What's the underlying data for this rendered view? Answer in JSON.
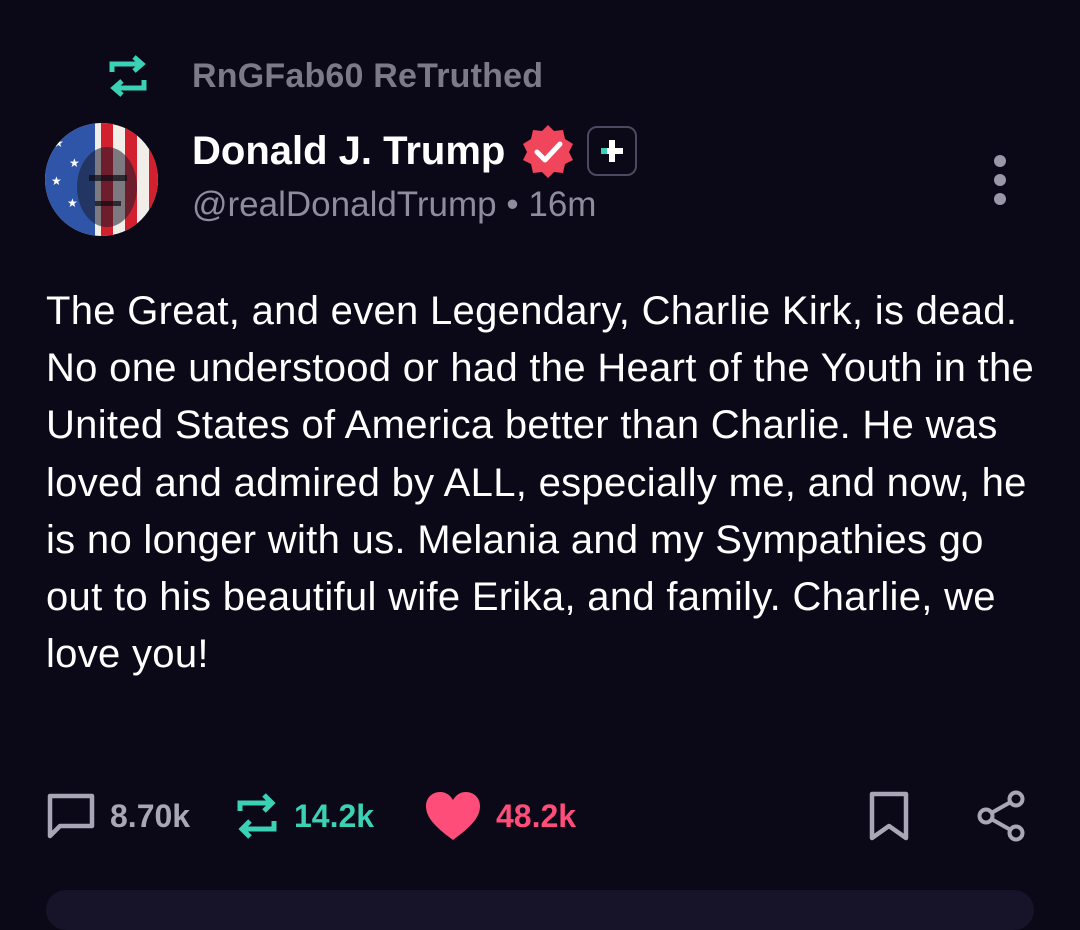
{
  "retruth_banner": {
    "label": "RnGFab60 ReTruthed",
    "icon": "retruth-icon"
  },
  "author": {
    "display_name": "Donald J. Trump",
    "handle": "@realDonaldTrump",
    "separator": "•",
    "time_ago": "16m",
    "verified_icon": "verified-badge-icon",
    "plus_icon": "plus-icon",
    "avatar": "avatar-image"
  },
  "post": {
    "text": "The Great, and even Legendary, Charlie Kirk, is dead. No one understood or had the Heart of the Youth in the United States of America better than Charlie. He was loved and admired by ALL, especially me, and now, he is no longer with us. Melania and my Sympathies go out to his beautiful wife Erika, and family. Charlie, we love you!"
  },
  "actions": {
    "reply_count": "8.70k",
    "retruth_count": "14.2k",
    "like_count": "48.2k",
    "reply_icon": "comment-icon",
    "retruth_icon": "retruth-icon",
    "like_icon": "heart-icon",
    "bookmark_icon": "bookmark-icon",
    "share_icon": "share-icon",
    "more_icon": "more-vertical-icon"
  },
  "colors": {
    "background": "#0b0818",
    "accent_teal": "#3bd1b5",
    "like_pink": "#ff4d7a",
    "muted_text": "#8f8c9d",
    "verified_red": "#f0455a"
  }
}
